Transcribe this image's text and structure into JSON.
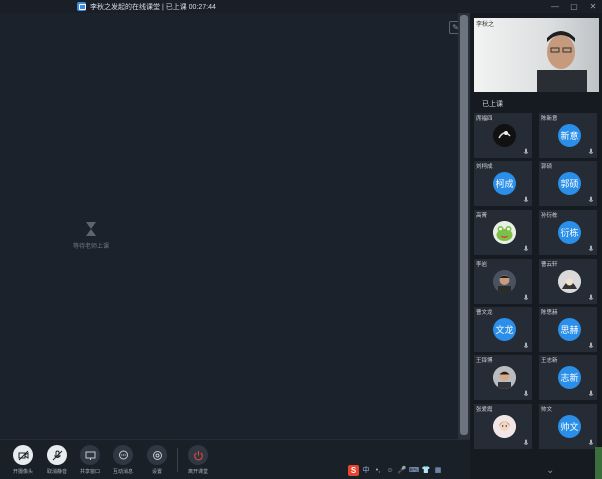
{
  "window": {
    "title": "李秋之发起的在线课堂 | 已上课 00:27:44",
    "controls": [
      "—",
      "▢",
      "✕"
    ]
  },
  "main": {
    "waiting_text": "等待老师上课"
  },
  "toolbar": {
    "items": [
      {
        "label": "开摄像头",
        "icon": "camera-off-icon",
        "glyph": "⊘"
      },
      {
        "label": "取消静音",
        "icon": "mic-off-icon",
        "glyph": "🎙"
      },
      {
        "label": "共享窗口",
        "icon": "screen-share-icon",
        "glyph": "▭"
      },
      {
        "label": "互动消息",
        "icon": "chat-icon",
        "glyph": "…"
      },
      {
        "label": "设置",
        "icon": "gear-icon",
        "glyph": "◎"
      },
      {
        "label": "离开课堂",
        "icon": "power-icon",
        "glyph": "⏻"
      }
    ]
  },
  "sidebar": {
    "teacher_name": "李秋之",
    "status": "已上课",
    "students": [
      {
        "name": "席福四",
        "avatar": "",
        "type": "photo-dark"
      },
      {
        "name": "陈新意",
        "avatar": "新意",
        "type": "blue"
      },
      {
        "name": "刘柯成",
        "avatar": "柯成",
        "type": "blue"
      },
      {
        "name": "郭硕",
        "avatar": "郭硕",
        "type": "blue"
      },
      {
        "name": "高菁",
        "avatar": "",
        "type": "photo-frog"
      },
      {
        "name": "孙衍栋",
        "avatar": "衍栋",
        "type": "blue"
      },
      {
        "name": "李岩",
        "avatar": "",
        "type": "photo-person"
      },
      {
        "name": "曹云轩",
        "avatar": "",
        "type": "photo-cartoon"
      },
      {
        "name": "曹文龙",
        "avatar": "文龙",
        "type": "blue"
      },
      {
        "name": "陈思赫",
        "avatar": "思赫",
        "type": "blue"
      },
      {
        "name": "王铎博",
        "avatar": "",
        "type": "photo-boy"
      },
      {
        "name": "王志新",
        "avatar": "志新",
        "type": "blue"
      },
      {
        "name": "张爱霞",
        "avatar": "",
        "type": "photo-girl"
      },
      {
        "name": "帅文",
        "avatar": "帅文",
        "type": "blue"
      }
    ]
  },
  "ime": {
    "logo": "S",
    "items": [
      "中",
      "•,",
      "☺",
      "🎤",
      "⌨",
      "👕",
      "▦"
    ]
  },
  "colors": {
    "accent": "#2b8fe9",
    "background": "#1c222b",
    "sidebar": "#161b22",
    "danger": "#e0473c"
  }
}
